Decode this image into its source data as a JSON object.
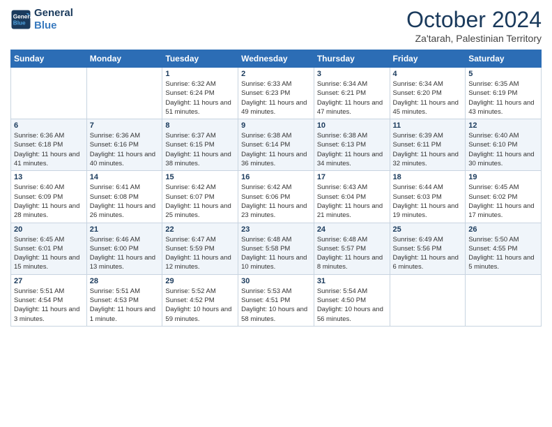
{
  "logo": {
    "line1": "General",
    "line2": "Blue"
  },
  "header": {
    "month": "October 2024",
    "location": "Za'tarah, Palestinian Territory"
  },
  "weekdays": [
    "Sunday",
    "Monday",
    "Tuesday",
    "Wednesday",
    "Thursday",
    "Friday",
    "Saturday"
  ],
  "weeks": [
    [
      {
        "day": "",
        "info": ""
      },
      {
        "day": "",
        "info": ""
      },
      {
        "day": "1",
        "info": "Sunrise: 6:32 AM\nSunset: 6:24 PM\nDaylight: 11 hours and 51 minutes."
      },
      {
        "day": "2",
        "info": "Sunrise: 6:33 AM\nSunset: 6:23 PM\nDaylight: 11 hours and 49 minutes."
      },
      {
        "day": "3",
        "info": "Sunrise: 6:34 AM\nSunset: 6:21 PM\nDaylight: 11 hours and 47 minutes."
      },
      {
        "day": "4",
        "info": "Sunrise: 6:34 AM\nSunset: 6:20 PM\nDaylight: 11 hours and 45 minutes."
      },
      {
        "day": "5",
        "info": "Sunrise: 6:35 AM\nSunset: 6:19 PM\nDaylight: 11 hours and 43 minutes."
      }
    ],
    [
      {
        "day": "6",
        "info": "Sunrise: 6:36 AM\nSunset: 6:18 PM\nDaylight: 11 hours and 41 minutes."
      },
      {
        "day": "7",
        "info": "Sunrise: 6:36 AM\nSunset: 6:16 PM\nDaylight: 11 hours and 40 minutes."
      },
      {
        "day": "8",
        "info": "Sunrise: 6:37 AM\nSunset: 6:15 PM\nDaylight: 11 hours and 38 minutes."
      },
      {
        "day": "9",
        "info": "Sunrise: 6:38 AM\nSunset: 6:14 PM\nDaylight: 11 hours and 36 minutes."
      },
      {
        "day": "10",
        "info": "Sunrise: 6:38 AM\nSunset: 6:13 PM\nDaylight: 11 hours and 34 minutes."
      },
      {
        "day": "11",
        "info": "Sunrise: 6:39 AM\nSunset: 6:11 PM\nDaylight: 11 hours and 32 minutes."
      },
      {
        "day": "12",
        "info": "Sunrise: 6:40 AM\nSunset: 6:10 PM\nDaylight: 11 hours and 30 minutes."
      }
    ],
    [
      {
        "day": "13",
        "info": "Sunrise: 6:40 AM\nSunset: 6:09 PM\nDaylight: 11 hours and 28 minutes."
      },
      {
        "day": "14",
        "info": "Sunrise: 6:41 AM\nSunset: 6:08 PM\nDaylight: 11 hours and 26 minutes."
      },
      {
        "day": "15",
        "info": "Sunrise: 6:42 AM\nSunset: 6:07 PM\nDaylight: 11 hours and 25 minutes."
      },
      {
        "day": "16",
        "info": "Sunrise: 6:42 AM\nSunset: 6:06 PM\nDaylight: 11 hours and 23 minutes."
      },
      {
        "day": "17",
        "info": "Sunrise: 6:43 AM\nSunset: 6:04 PM\nDaylight: 11 hours and 21 minutes."
      },
      {
        "day": "18",
        "info": "Sunrise: 6:44 AM\nSunset: 6:03 PM\nDaylight: 11 hours and 19 minutes."
      },
      {
        "day": "19",
        "info": "Sunrise: 6:45 AM\nSunset: 6:02 PM\nDaylight: 11 hours and 17 minutes."
      }
    ],
    [
      {
        "day": "20",
        "info": "Sunrise: 6:45 AM\nSunset: 6:01 PM\nDaylight: 11 hours and 15 minutes."
      },
      {
        "day": "21",
        "info": "Sunrise: 6:46 AM\nSunset: 6:00 PM\nDaylight: 11 hours and 13 minutes."
      },
      {
        "day": "22",
        "info": "Sunrise: 6:47 AM\nSunset: 5:59 PM\nDaylight: 11 hours and 12 minutes."
      },
      {
        "day": "23",
        "info": "Sunrise: 6:48 AM\nSunset: 5:58 PM\nDaylight: 11 hours and 10 minutes."
      },
      {
        "day": "24",
        "info": "Sunrise: 6:48 AM\nSunset: 5:57 PM\nDaylight: 11 hours and 8 minutes."
      },
      {
        "day": "25",
        "info": "Sunrise: 6:49 AM\nSunset: 5:56 PM\nDaylight: 11 hours and 6 minutes."
      },
      {
        "day": "26",
        "info": "Sunrise: 5:50 AM\nSunset: 4:55 PM\nDaylight: 11 hours and 5 minutes."
      }
    ],
    [
      {
        "day": "27",
        "info": "Sunrise: 5:51 AM\nSunset: 4:54 PM\nDaylight: 11 hours and 3 minutes."
      },
      {
        "day": "28",
        "info": "Sunrise: 5:51 AM\nSunset: 4:53 PM\nDaylight: 11 hours and 1 minute."
      },
      {
        "day": "29",
        "info": "Sunrise: 5:52 AM\nSunset: 4:52 PM\nDaylight: 10 hours and 59 minutes."
      },
      {
        "day": "30",
        "info": "Sunrise: 5:53 AM\nSunset: 4:51 PM\nDaylight: 10 hours and 58 minutes."
      },
      {
        "day": "31",
        "info": "Sunrise: 5:54 AM\nSunset: 4:50 PM\nDaylight: 10 hours and 56 minutes."
      },
      {
        "day": "",
        "info": ""
      },
      {
        "day": "",
        "info": ""
      }
    ]
  ]
}
